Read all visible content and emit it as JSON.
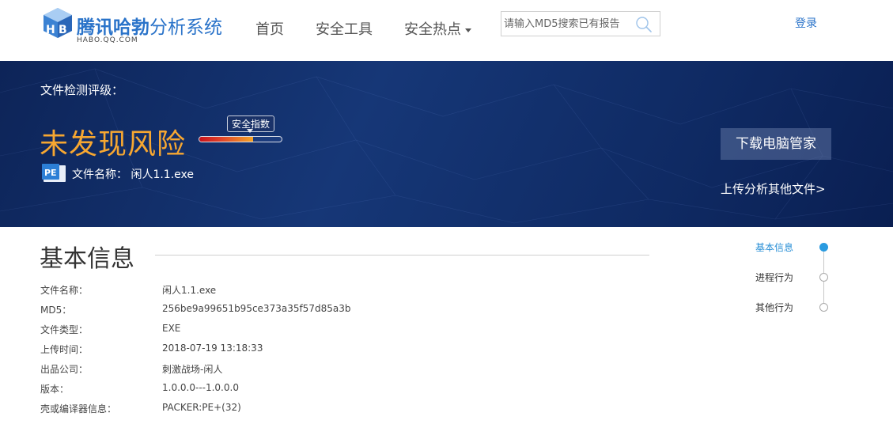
{
  "header": {
    "logo_brand": "腾讯哈勃",
    "logo_sub": "分析系统",
    "logo_domain": "HABO.QQ.COM",
    "nav": {
      "home": "首页",
      "tools": "安全工具",
      "hot": "安全热点"
    },
    "search": {
      "placeholder": "请输入MD5搜索已有报告"
    },
    "login": "登录"
  },
  "banner": {
    "rating_label": "文件检测评级：",
    "risk_result": "未发现风险",
    "safety_tag": "安全指数",
    "safety_level": 0.65,
    "file_type_icon": "PE",
    "file_name_label": "文件名称：",
    "file_name_value": "闲人1.1.exe",
    "download_button": "下载电脑管家",
    "upload_link": "上传分析其他文件>"
  },
  "basic_info": {
    "title": "基本信息",
    "rows": [
      {
        "label": "文件名称：",
        "value": "闲人1.1.exe"
      },
      {
        "label": "MD5：",
        "value": "256be9a99651b95ce373a35f57d85a3b"
      },
      {
        "label": "文件类型：",
        "value": "EXE"
      },
      {
        "label": "上传时间：",
        "value": "2018-07-19 13:18:33"
      },
      {
        "label": "出品公司：",
        "value": "刺激战场-闲人"
      },
      {
        "label": "版本：",
        "value": "1.0.0.0---1.0.0.0"
      },
      {
        "label": "壳或编译器信息：",
        "value": "PACKER:PE+(32)"
      }
    ]
  },
  "side_nav": {
    "items": [
      {
        "label": "基本信息",
        "active": true
      },
      {
        "label": "进程行为",
        "active": false
      },
      {
        "label": "其他行为",
        "active": false
      }
    ]
  },
  "colors": {
    "brand_blue": "#2a73c9",
    "banner_bg": "#163777",
    "risk_orange": "#f7a731",
    "active_dot": "#2a9be0"
  }
}
